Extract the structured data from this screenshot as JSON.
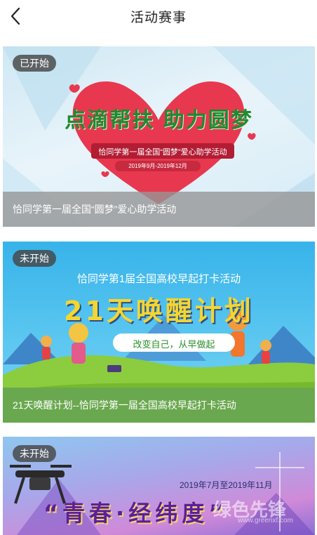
{
  "header": {
    "title": "活动赛事"
  },
  "cards": [
    {
      "status": "已开始",
      "caption": "恰同学第一届全国“圆梦”爱心助学活动",
      "banner": {
        "headline": "点滴帮扶 助力圆梦",
        "ribbon": "恰同学第一届全国“圆梦”爱心助学活动",
        "dates": "2019年9月-2019年12月"
      }
    },
    {
      "status": "未开始",
      "caption": "21天唤醒计划--恰同学第一届全国高校早起打卡活动",
      "banner": {
        "subtitle": "恰同学第1届全国高校早起打卡活动",
        "headline": "21天唤醒计划",
        "slogan": "改变自己，从早做起"
      }
    },
    {
      "status": "未开始",
      "banner": {
        "dates": "2019年7月至2019年11月",
        "headline": "“青春·经纬度”"
      }
    }
  ],
  "watermark": {
    "text": "绿色先锋",
    "url": "www.greenxf.com"
  },
  "colors": {
    "badge_bg": "#464646",
    "card2_caption_bg": "#6aa84f",
    "heart_red": "#e8384f"
  }
}
